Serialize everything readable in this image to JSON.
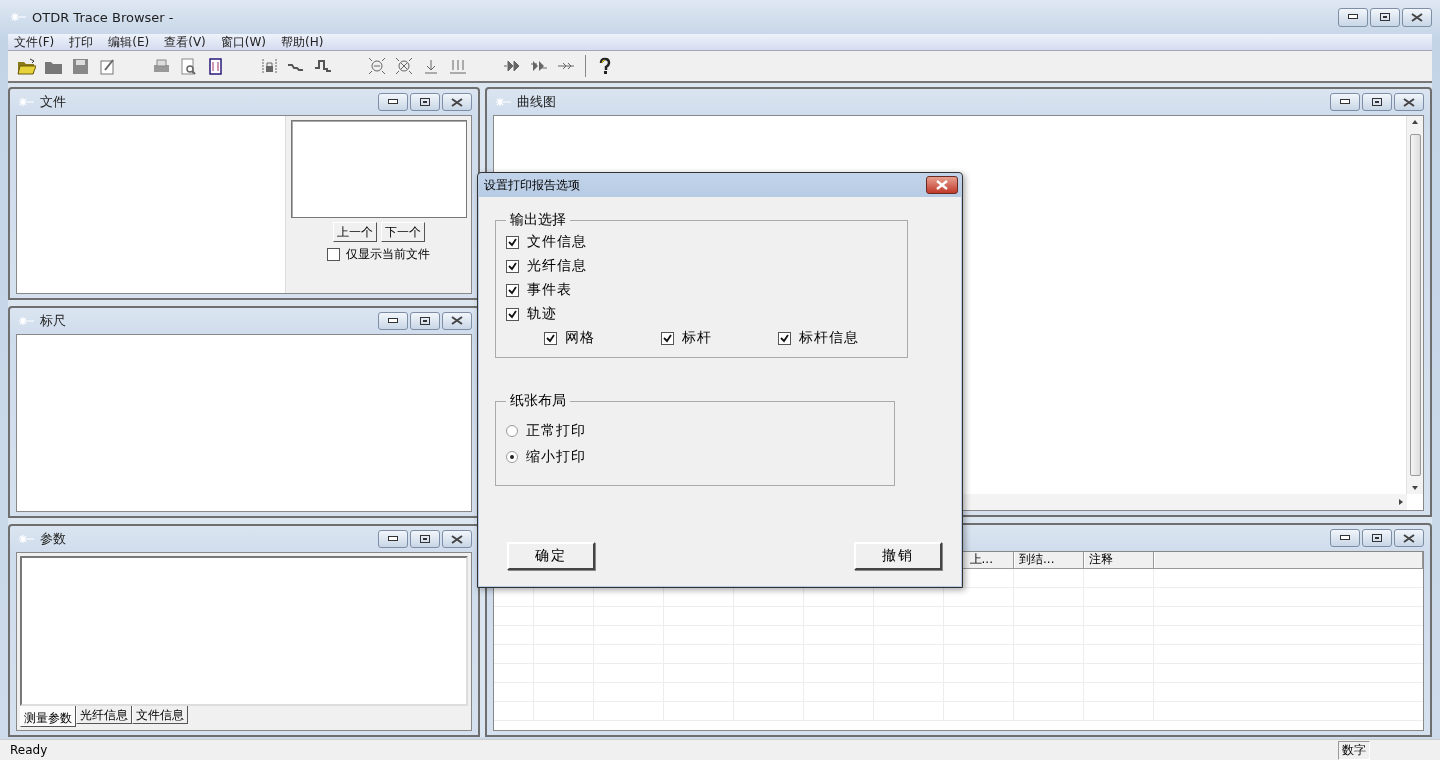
{
  "window": {
    "title": "OTDR Trace Browser -"
  },
  "menu": [
    "文件(F)",
    "打印",
    "编辑(E)",
    "查看(V)",
    "窗口(W)",
    "帮助(H)"
  ],
  "file_panel": {
    "title": "文件",
    "buttons": [
      "上一个",
      "下一个"
    ],
    "only_current": {
      "label": "仅显示当前文件",
      "checked": false
    }
  },
  "ruler_panel": {
    "title": "标尺"
  },
  "param_panel": {
    "title": "参数",
    "tabs": [
      {
        "label": "测量参数",
        "selected": true
      },
      {
        "label": "光纤信息",
        "selected": false
      },
      {
        "label": "文件信息",
        "selected": false
      }
    ]
  },
  "trace_panel": {
    "title": "曲线图"
  },
  "event_panel": {
    "columns": [
      "上...",
      "到结...",
      "注释"
    ]
  },
  "dialog": {
    "title": "设置打印报告选项",
    "output_group": {
      "title": "输出选择",
      "items": [
        {
          "label": "文件信息",
          "checked": true
        },
        {
          "label": "光纤信息",
          "checked": true
        },
        {
          "label": "事件表",
          "checked": true
        },
        {
          "label": "轨迹",
          "checked": true
        }
      ],
      "sub_items": [
        {
          "label": "网格",
          "checked": true
        },
        {
          "label": "标杆",
          "checked": true
        },
        {
          "label": "标杆信息",
          "checked": true
        }
      ]
    },
    "layout_group": {
      "title": "纸张布局",
      "options": [
        {
          "label": "正常打印",
          "selected": false
        },
        {
          "label": "缩小打印",
          "selected": true
        }
      ]
    },
    "buttons": [
      "确定",
      "撤销"
    ]
  },
  "status_bar": {
    "text": "Ready",
    "indicator": "数字"
  }
}
